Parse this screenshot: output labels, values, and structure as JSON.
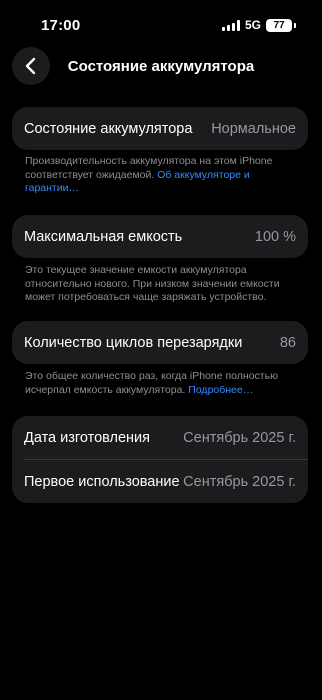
{
  "status_bar": {
    "time": "17:00",
    "network": "5G",
    "battery": "77"
  },
  "header": {
    "title": "Состояние аккумулятора",
    "back_icon": "chevron-left-icon"
  },
  "battery_state": {
    "label": "Состояние аккумулятора",
    "value": "Нормальное",
    "note": "Производительность аккумулятора на этом iPhone соответствует ожидаемой.",
    "link": "Об аккумуляторе и гарантии…"
  },
  "max_capacity": {
    "label": "Максимальная емкость",
    "value": "100 %",
    "note": "Это текущее значение емкости аккумулятора относительно нового. При низком значении емкости может потребоваться чаще заряжать устройство."
  },
  "cycle_count": {
    "label": "Количество циклов перезарядки",
    "value": "86",
    "note": "Это общее количество раз, когда iPhone полностью исчерпал емкость аккумулятора.",
    "link": "Подробнее…"
  },
  "dates": {
    "manufacture_label": "Дата изготовления",
    "manufacture_value": "Сентябрь 2025 г.",
    "first_use_label": "Первое использование",
    "first_use_value": "Сентябрь 2025 г."
  }
}
